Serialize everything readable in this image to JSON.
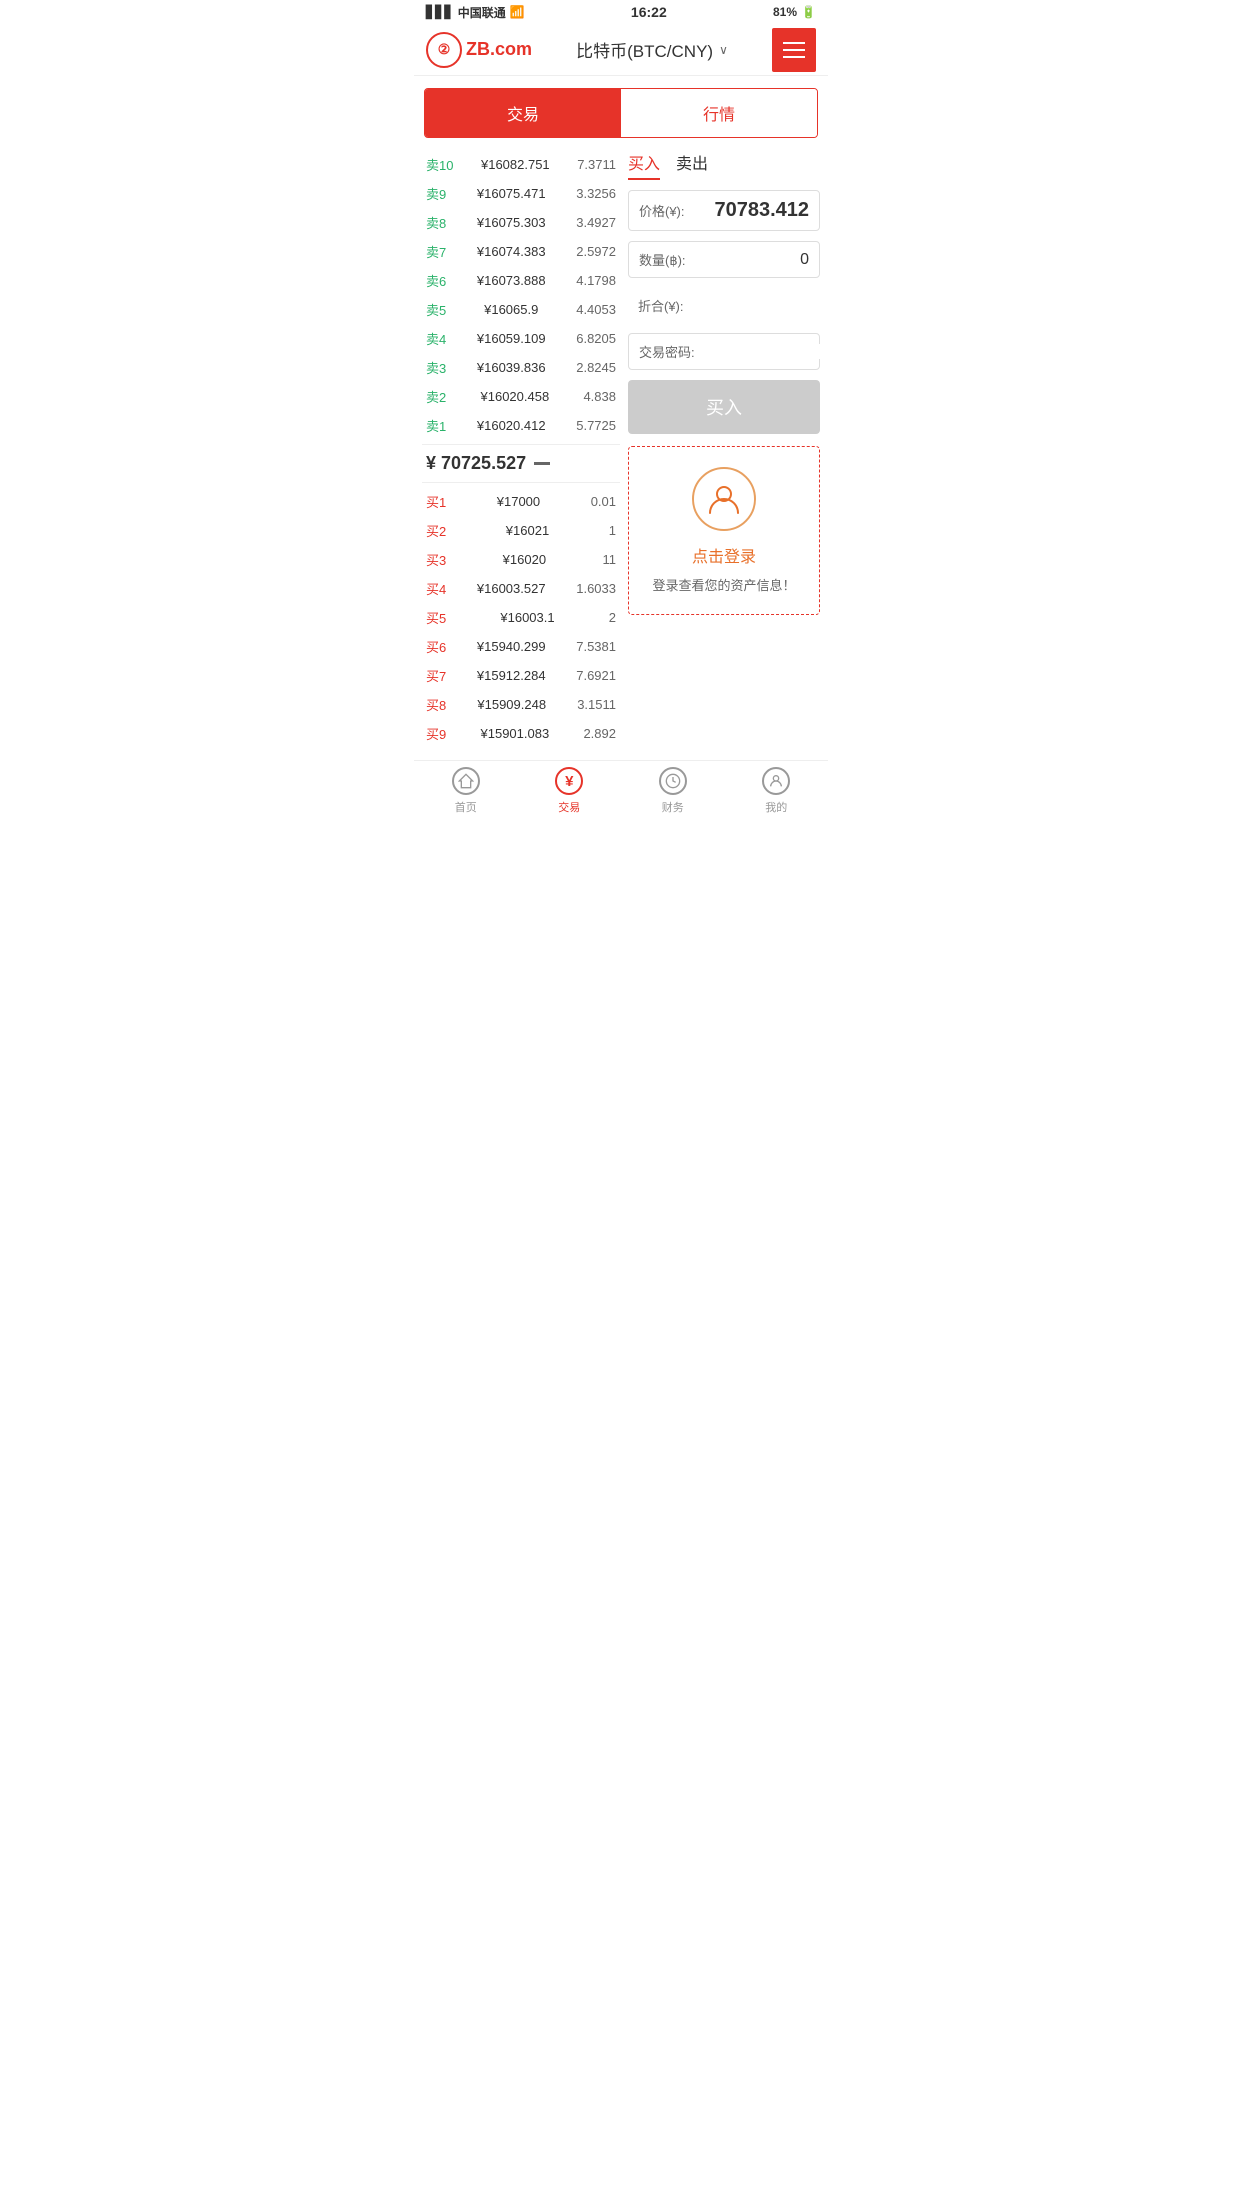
{
  "statusBar": {
    "carrier": "中国联通",
    "time": "16:22",
    "battery": "81%"
  },
  "header": {
    "logo": "ZB.com",
    "title": "比特币(BTC/CNY)",
    "menuIcon": "≡"
  },
  "topTabs": [
    {
      "label": "交易",
      "active": true
    },
    {
      "label": "行情",
      "active": false
    }
  ],
  "orderBook": {
    "sellOrders": [
      {
        "label": "卖10",
        "price": "¥16082.751",
        "qty": "7.3711"
      },
      {
        "label": "卖9",
        "price": "¥16075.471",
        "qty": "3.3256"
      },
      {
        "label": "卖8",
        "price": "¥16075.303",
        "qty": "3.4927"
      },
      {
        "label": "卖7",
        "price": "¥16074.383",
        "qty": "2.5972"
      },
      {
        "label": "卖6",
        "price": "¥16073.888",
        "qty": "4.1798"
      },
      {
        "label": "卖5",
        "price": "¥16065.9",
        "qty": "4.4053"
      },
      {
        "label": "卖4",
        "price": "¥16059.109",
        "qty": "6.8205"
      },
      {
        "label": "卖3",
        "price": "¥16039.836",
        "qty": "2.8245"
      },
      {
        "label": "卖2",
        "price": "¥16020.458",
        "qty": "4.838"
      },
      {
        "label": "卖1",
        "price": "¥16020.412",
        "qty": "5.7725"
      }
    ],
    "midPrice": "¥ 70725.527",
    "buyOrders": [
      {
        "label": "买1",
        "price": "¥17000",
        "qty": "0.01"
      },
      {
        "label": "买2",
        "price": "¥16021",
        "qty": "1"
      },
      {
        "label": "买3",
        "price": "¥16020",
        "qty": "11"
      },
      {
        "label": "买4",
        "price": "¥16003.527",
        "qty": "1.6033"
      },
      {
        "label": "买5",
        "price": "¥16003.1",
        "qty": "2"
      },
      {
        "label": "买6",
        "price": "¥15940.299",
        "qty": "7.5381"
      },
      {
        "label": "买7",
        "price": "¥15912.284",
        "qty": "7.6921"
      },
      {
        "label": "买8",
        "price": "¥15909.248",
        "qty": "3.1511"
      },
      {
        "label": "买9",
        "price": "¥15901.083",
        "qty": "2.892"
      }
    ]
  },
  "tradeForm": {
    "tabs": [
      {
        "label": "买入",
        "active": true
      },
      {
        "label": "卖出",
        "active": false
      }
    ],
    "priceLabel": "价格(¥):",
    "priceValue": "70783.412",
    "qtyLabel": "数量(฿):",
    "qtyValue": "0",
    "totalLabel": "折合(¥):",
    "totalValue": "",
    "passwordLabel": "交易密码:",
    "passwordValue": "",
    "buyBtnLabel": "买入",
    "loginPrompt": {
      "loginText": "点击登录",
      "subText": "登录查看您的资产信息！"
    }
  },
  "bottomNav": [
    {
      "label": "首页",
      "icon": "★",
      "active": false
    },
    {
      "label": "交易",
      "icon": "¥",
      "active": true
    },
    {
      "label": "财务",
      "icon": "💰",
      "active": false
    },
    {
      "label": "我的",
      "icon": "👤",
      "active": false
    }
  ]
}
